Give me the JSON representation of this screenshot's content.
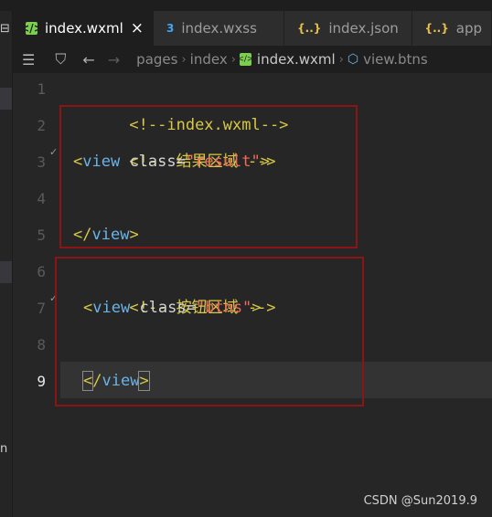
{
  "tabs": [
    {
      "label": "index.wxml",
      "icon": "wxml-file-icon",
      "active": true
    },
    {
      "label": "index.wxss",
      "icon": "css-file-icon",
      "active": false
    },
    {
      "label": "index.json",
      "icon": "json-file-icon",
      "active": false
    },
    {
      "label": "app",
      "icon": "json-file-icon",
      "active": false
    }
  ],
  "tab_close": "×",
  "breadcrumb": {
    "crumbs": [
      "pages",
      "index",
      "index.wxml",
      "view.btns"
    ]
  },
  "left_edge_text": "n",
  "lines": [
    {
      "number": "1"
    },
    {
      "number": "2"
    },
    {
      "number": "3"
    },
    {
      "number": "4"
    },
    {
      "number": "5"
    },
    {
      "number": "6"
    },
    {
      "number": "7"
    },
    {
      "number": "8"
    },
    {
      "number": "9"
    }
  ],
  "code": {
    "l1_comment": "<!--index.wxml-->",
    "l2_comment": "<!-- 结果区域 -->",
    "l3_open": "<",
    "l3_tag": "view",
    "l3_attr": " class",
    "l3_eq": "=",
    "l3_str": "\"result\"",
    "l3_close": ">",
    "l5_open": "</",
    "l5_tag": "view",
    "l5_close": ">",
    "l6_comment": "<!-- 按钮区域 -->",
    "l7_open": "<",
    "l7_tag": "view",
    "l7_attr": " class",
    "l7_eq": "=",
    "l7_str": "\"btns\"",
    "l7_close": ">",
    "l9_open": "<",
    "l9_slash": "/",
    "l9_tag": "view",
    "l9_close": ">"
  },
  "watermark": "CSDN @Sun2019.9",
  "colors": {
    "comment": "#d8c845",
    "tag": "#6ab3e8",
    "string": "#ef6b5a",
    "annotation_box": "#8b1414"
  }
}
